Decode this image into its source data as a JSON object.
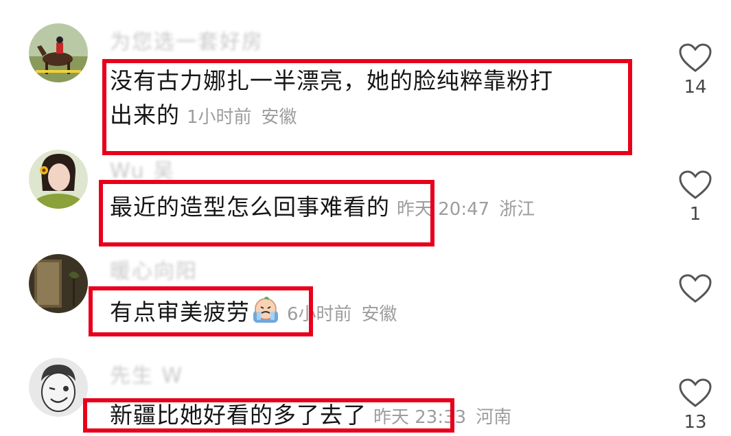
{
  "comments": [
    {
      "username": "为您选一套好房",
      "text_line1": "没有古力娜扎一半漂亮，她的脸纯粹靠粉打",
      "text_line2": "出来的",
      "time": "1小时前",
      "location": "安徽",
      "likes": "14",
      "avatar_icon": "horse-rider-avatar"
    },
    {
      "username": "Wu 吴",
      "text": "最近的造型怎么回事难看的",
      "time": "昨天 20:47",
      "location": "浙江",
      "likes": "1",
      "avatar_icon": "woman-sunflower-avatar"
    },
    {
      "username": "暖心向阳",
      "text": "有点审美疲劳",
      "emoji": "crying-emoji",
      "time": "6小时前",
      "location": "安徽",
      "likes": "",
      "avatar_icon": "room-avatar"
    },
    {
      "username": "先生 W",
      "text": "新疆比她好看的多了去了",
      "time": "昨天 23:33",
      "location": "河南",
      "likes": "13",
      "avatar_icon": "cartoon-boy-avatar"
    }
  ],
  "colors": {
    "highlight": "#e8001b",
    "meta": "#9d9d9d",
    "text": "#161616"
  }
}
